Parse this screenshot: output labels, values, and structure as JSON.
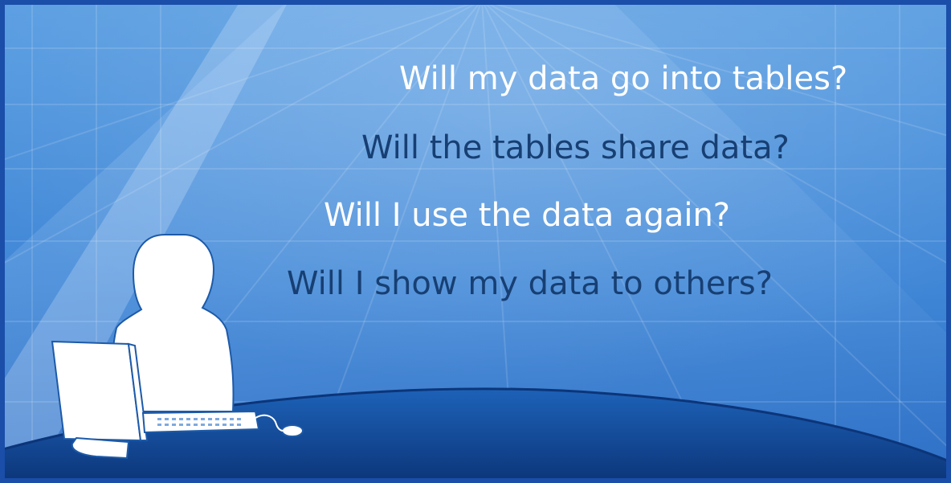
{
  "slide": {
    "questions": [
      {
        "text": "Will my data go into tables?",
        "tone": "light"
      },
      {
        "text": "Will the tables share data?",
        "tone": "dark"
      },
      {
        "text": "Will I use the data again?",
        "tone": "light"
      },
      {
        "text": "Will I show my data to others?",
        "tone": "dark"
      }
    ]
  },
  "colors": {
    "background_top": "#5a9fe0",
    "background_bottom": "#1d5fb8",
    "floor": "#0f3f86",
    "frame": "#1a4ea8",
    "text_light": "#ffffff",
    "text_dark": "#173f73"
  },
  "illustration": {
    "icon": "person-at-computer-icon"
  }
}
